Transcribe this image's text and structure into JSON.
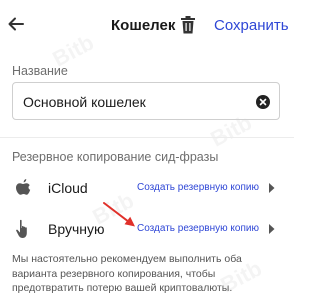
{
  "header": {
    "back_icon": "arrow-left-icon",
    "title": "Кошелек",
    "delete_icon": "trash-icon",
    "save_label": "Сохранить"
  },
  "name_section": {
    "label": "Название",
    "value": "Основной кошелек",
    "clear_icon": "clear-circle-x-icon"
  },
  "backup_section": {
    "title": "Резервное копирование сид-фразы",
    "rows": [
      {
        "icon": "apple-icon",
        "label": "iCloud",
        "action": "Создать резервную копию",
        "chevron_icon": "chevron-right-icon"
      },
      {
        "icon": "hand-pointer-icon",
        "label": "Вручную",
        "action": "Создать резервную копию",
        "chevron_icon": "chevron-right-icon"
      }
    ]
  },
  "note": "Мы настоятельно рекомендуем выполнить оба варианта резервного копирования, чтобы предотвратить потерю вашей криптовалюты.",
  "annotation": {
    "icon": "red-arrow-icon",
    "color": "#e0302a"
  },
  "colors": {
    "accent": "#2f47d6",
    "text": "#1a1a1a",
    "muted": "#6e6e6e"
  }
}
